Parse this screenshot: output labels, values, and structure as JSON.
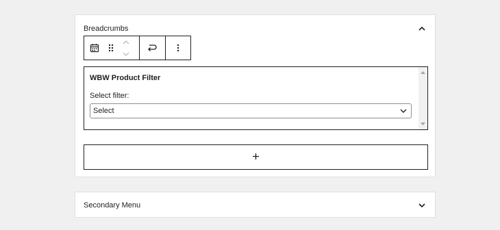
{
  "panels": {
    "breadcrumbs": {
      "title": "Breadcrumbs",
      "expanded": true
    },
    "secondary_menu": {
      "title": "Secondary Menu",
      "expanded": false
    }
  },
  "toolbar": {
    "icons": [
      "calendar-icon",
      "drag-handle-icon",
      "move-up-icon",
      "move-down-icon",
      "transform-icon",
      "more-options-icon"
    ]
  },
  "widget": {
    "title": "WBW Product Filter",
    "filter_label": "Select filter:",
    "select_value": "Select"
  },
  "add_block": {
    "icon": "plus-icon"
  }
}
